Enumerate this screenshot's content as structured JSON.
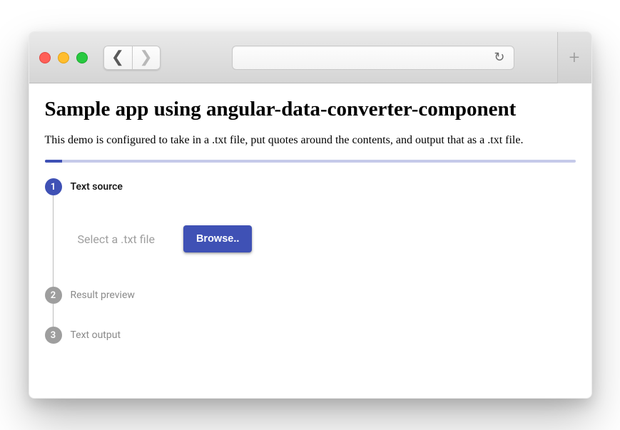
{
  "page": {
    "title": "Sample app using angular-data-converter-component",
    "description": "This demo is configured to take in a .txt file, put quotes around the contents, and output that as a .txt file."
  },
  "steps": [
    {
      "num": "1",
      "label": "Text source",
      "active": true
    },
    {
      "num": "2",
      "label": "Result preview",
      "active": false
    },
    {
      "num": "3",
      "label": "Text output",
      "active": false
    }
  ],
  "fileSelect": {
    "hint": "Select a .txt file",
    "browseLabel": "Browse.."
  },
  "colors": {
    "primary": "#3f51b5",
    "primaryLight": "#c5cae9",
    "inactiveGrey": "#9e9e9e"
  }
}
